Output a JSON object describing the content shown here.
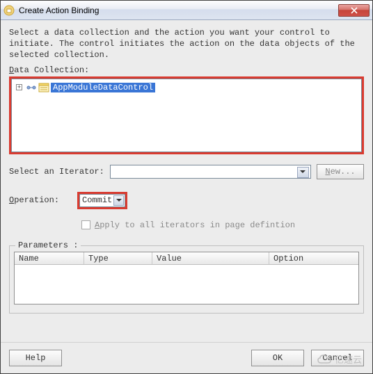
{
  "window": {
    "title": "Create Action Binding"
  },
  "description": "Select a data collection and the action you want your control to initiate. The control initiates the action on the data objects of the selected collection.",
  "dataCollection": {
    "label_pre": "D",
    "label_rest": "ata Collection:",
    "tree": {
      "expanded": false,
      "item": "AppModuleDataControl"
    }
  },
  "iterator": {
    "label": "Select an Iterator:",
    "value": "",
    "newButton_pre": "N",
    "newButton_rest": "ew..."
  },
  "operation": {
    "label_pre": "O",
    "label_rest": "peration:",
    "value": "Commit"
  },
  "applyAll": {
    "checked": false,
    "label_pre": "A",
    "label_rest": "pply to all iterators in page defintion"
  },
  "parameters": {
    "legend": "Parameters :",
    "columns": {
      "name": "Name",
      "type": "Type",
      "value": "Value",
      "option": "Option"
    }
  },
  "buttons": {
    "help": "Help",
    "ok": "OK",
    "cancel": "Cancel"
  },
  "watermark": "亿速云"
}
